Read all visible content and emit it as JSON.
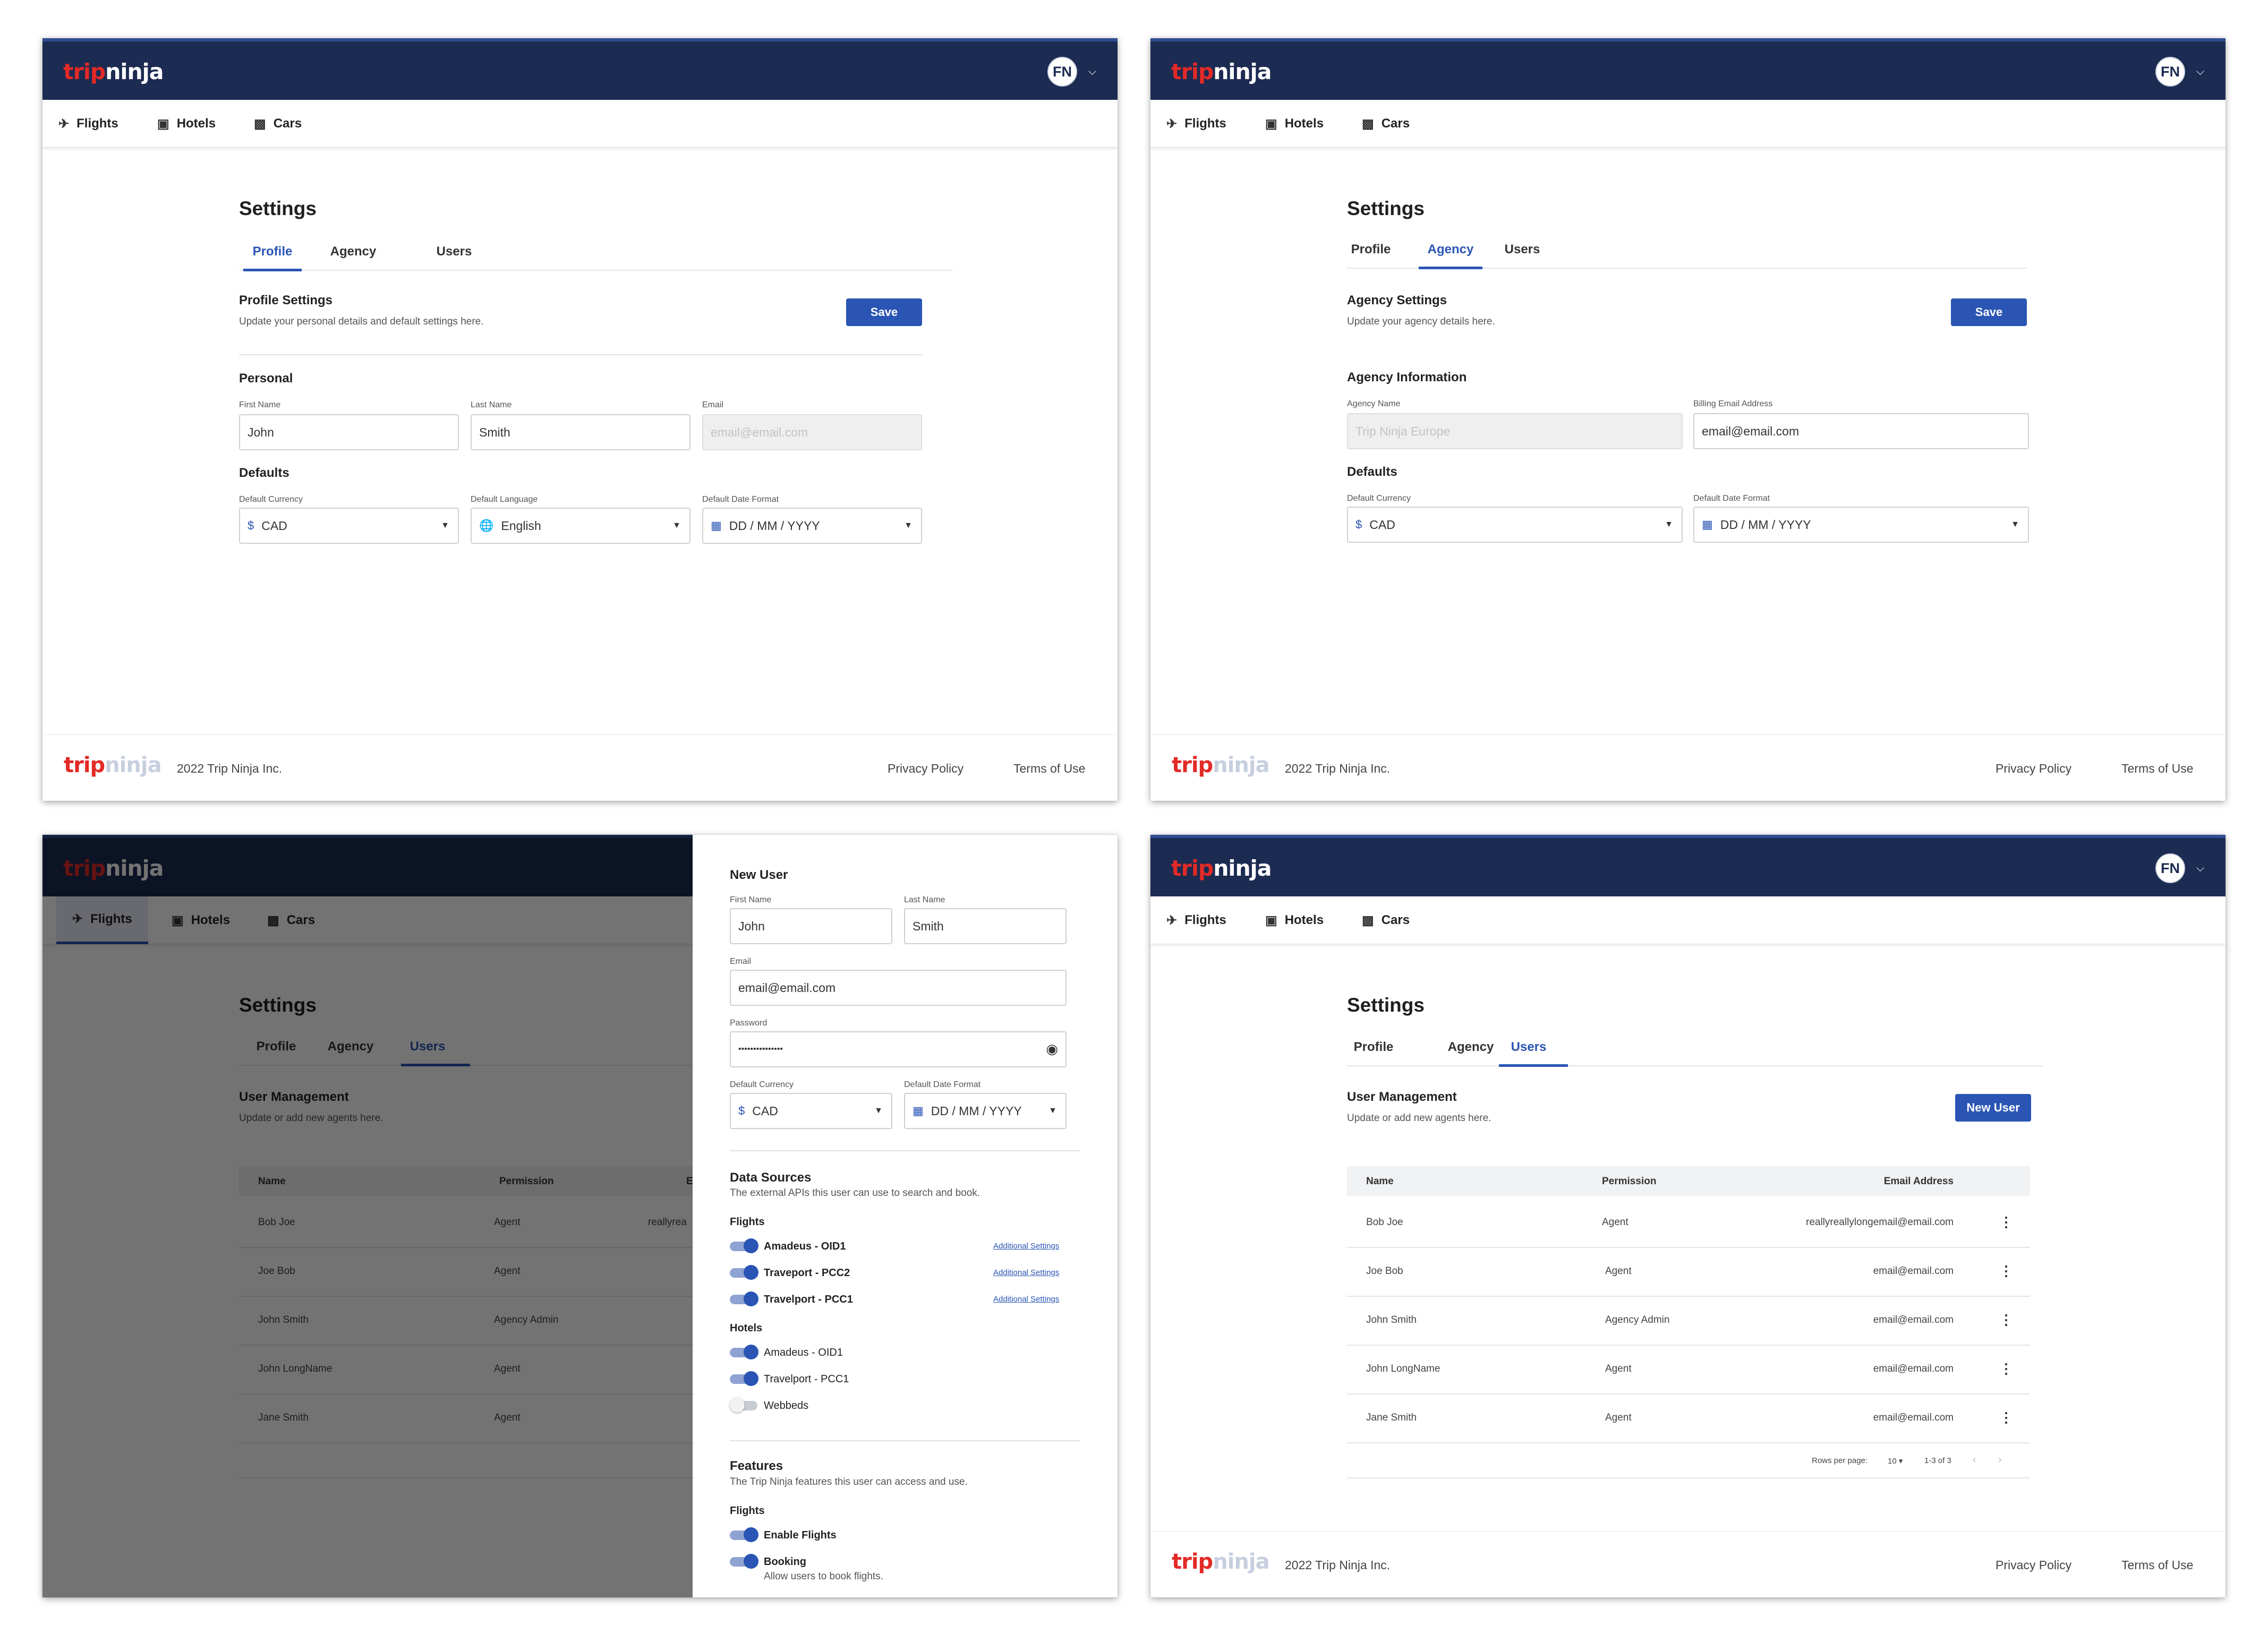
{
  "brand": {
    "logo_trip": "trip",
    "logo_ninja": "ninja",
    "avatar_initials": "FN"
  },
  "nav": {
    "flights": "Flights",
    "hotels": "Hotels",
    "cars": "Cars"
  },
  "settings": {
    "title": "Settings",
    "tabs": {
      "profile": "Profile",
      "agency": "Agency",
      "users": "Users"
    }
  },
  "footer": {
    "copyright": "2022 Trip Ninja Inc.",
    "privacy": "Privacy Policy",
    "terms": "Terms of Use"
  },
  "profile": {
    "section_title": "Profile Settings",
    "section_sub": "Update your personal details and default settings here.",
    "save_label": "Save",
    "personal_title": "Personal",
    "first_name_label": "First Name",
    "first_name": "John",
    "last_name_label": "Last Name",
    "last_name": "Smith",
    "email_label": "Email",
    "email_placeholder": "email@email.com",
    "defaults_title": "Defaults",
    "currency_label": "Default Currency",
    "currency": "CAD",
    "language_label": "Default Language",
    "language": "English",
    "date_label": "Default Date Format",
    "date_format": "DD / MM / YYYY"
  },
  "agency": {
    "section_title": "Agency Settings",
    "section_sub": "Update your agency details here.",
    "save_label": "Save",
    "info_title": "Agency Information",
    "name_label": "Agency Name",
    "name": "Trip Ninja Europe",
    "billing_label": "Billing Email Address",
    "billing": "email@email.com",
    "defaults_title": "Defaults",
    "currency_label": "Default Currency",
    "currency": "CAD",
    "date_label": "Default Date Format",
    "date_format": "DD / MM / YYYY"
  },
  "users": {
    "section_title": "User Management",
    "section_sub": "Update or add new agents here.",
    "new_user_label": "New User",
    "columns": {
      "name": "Name",
      "permission": "Permission",
      "email": "Email Address"
    },
    "rows": [
      {
        "name": "Bob Joe",
        "permission": "Agent",
        "email": "reallyreallylongemail@email.com"
      },
      {
        "name": "Joe Bob",
        "permission": "Agent",
        "email": "email@email.com"
      },
      {
        "name": "John Smith",
        "permission": "Agency Admin",
        "email": "email@email.com"
      },
      {
        "name": "John LongName",
        "permission": "Agent",
        "email": "email@email.com"
      },
      {
        "name": "Jane Smith",
        "permission": "Agent",
        "email": "email@email.com"
      }
    ],
    "overlay_email_cut": "reallyrea",
    "pagination": {
      "rows_per_page_label": "Rows per page:",
      "rows_per_page": "10",
      "range": "1-3 of 3"
    }
  },
  "new_user": {
    "title": "New User",
    "first_name_label": "First Name",
    "first_name": "John",
    "last_name_label": "Last Name",
    "last_name": "Smith",
    "email_label": "Email",
    "email": "email@email.com",
    "password_label": "Password",
    "password": "•••••••••••••••",
    "currency_label": "Default Currency",
    "currency": "CAD",
    "date_label": "Default Date Format",
    "date_format": "DD / MM / YYYY",
    "data_sources_title": "Data Sources",
    "data_sources_sub": "The external APIs this user can use to search and book.",
    "flights_label": "Flights",
    "flight_sources": [
      {
        "name": "Amadeus - OID1",
        "on": true,
        "link": "Additional Settings"
      },
      {
        "name": "Traveport - PCC2",
        "on": true,
        "link": "Additional Settings"
      },
      {
        "name": "Travelport - PCC1",
        "on": true,
        "link": "Additional Settings"
      }
    ],
    "hotels_label": "Hotels",
    "hotel_sources": [
      {
        "name": "Amadeus - OID1",
        "on": true
      },
      {
        "name": "Travelport - PCC1",
        "on": true
      },
      {
        "name": "Webbeds",
        "on": false
      }
    ],
    "features_title": "Features",
    "features_sub": "The Trip Ninja features this user can access and use.",
    "features_flights_label": "Flights",
    "enable_flights": "Enable Flights",
    "booking": "Booking",
    "booking_sub": "Allow users to book flights."
  },
  "colors": {
    "header": "#1c2b52",
    "accent": "#2a55b4",
    "brand_red": "#e32a26"
  }
}
